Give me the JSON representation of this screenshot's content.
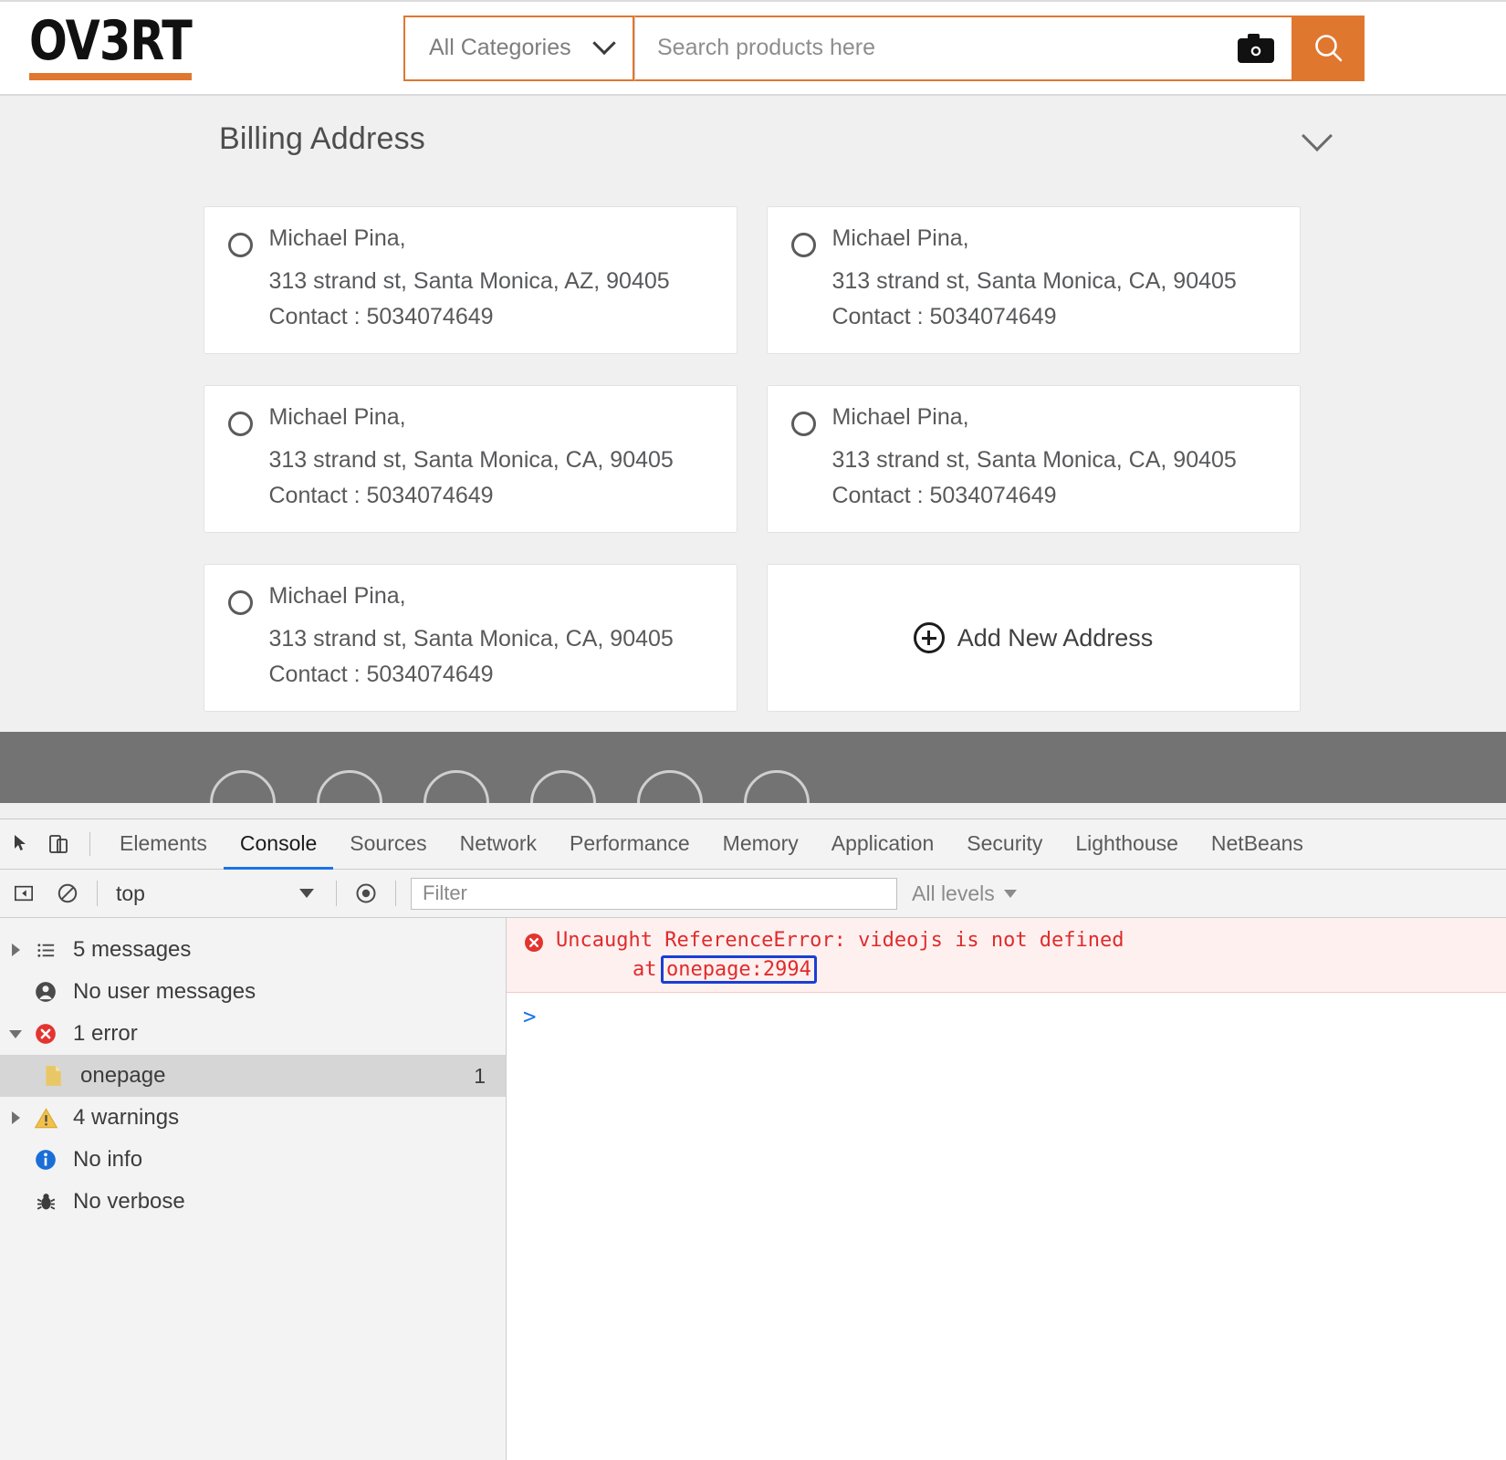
{
  "header": {
    "logo_text": "OV3RT",
    "category_select": {
      "label": "All Categories",
      "icon": "chevron-down-icon"
    },
    "search": {
      "placeholder": "Search products here",
      "value": ""
    },
    "camera_icon": "camera-icon",
    "search_icon": "search-icon",
    "accent_color": "#e0772f"
  },
  "billing": {
    "title": "Billing Address",
    "collapse_icon": "chevron-down-icon",
    "addresses": [
      {
        "name": "Michael Pina,",
        "street": "313 strand st, Santa Monica, AZ, 90405",
        "contact": "Contact : 5034074649",
        "selected": false
      },
      {
        "name": "Michael Pina,",
        "street": "313 strand st, Santa Monica, CA, 90405",
        "contact": "Contact : 5034074649",
        "selected": false
      },
      {
        "name": "Michael Pina,",
        "street": "313 strand st, Santa Monica, CA, 90405",
        "contact": "Contact : 5034074649",
        "selected": false
      },
      {
        "name": "Michael Pina,",
        "street": "313 strand st, Santa Monica, CA, 90405",
        "contact": "Contact : 5034074649",
        "selected": false
      },
      {
        "name": "Michael Pina,",
        "street": "313 strand st, Santa Monica, CA, 90405",
        "contact": "Contact : 5034074649",
        "selected": false
      }
    ],
    "add_new": {
      "label": "Add New Address",
      "icon": "plus-circle-icon"
    }
  },
  "devtools": {
    "tools": [
      "inspect-element-icon",
      "device-toolbar-icon"
    ],
    "tabs": [
      {
        "label": "Elements",
        "active": false
      },
      {
        "label": "Console",
        "active": true
      },
      {
        "label": "Sources",
        "active": false
      },
      {
        "label": "Network",
        "active": false
      },
      {
        "label": "Performance",
        "active": false
      },
      {
        "label": "Memory",
        "active": false
      },
      {
        "label": "Application",
        "active": false
      },
      {
        "label": "Security",
        "active": false
      },
      {
        "label": "Lighthouse",
        "active": false
      },
      {
        "label": "NetBeans",
        "active": false
      }
    ],
    "toolbar": {
      "sidebar_toggle_icon": "console-sidebar-toggle-icon",
      "clear_icon": "clear-console-icon",
      "context": "top",
      "eye_icon": "live-expression-icon",
      "filter_placeholder": "Filter",
      "filter_value": "",
      "levels_label": "All levels"
    },
    "sidebar": [
      {
        "label": "5 messages",
        "icon": "list-icon",
        "arrow": "right",
        "count": "",
        "selected": false,
        "child": false
      },
      {
        "label": "No user messages",
        "icon": "user-icon",
        "arrow": "none",
        "count": "",
        "selected": false,
        "child": false
      },
      {
        "label": "1 error",
        "icon": "error-icon",
        "arrow": "down",
        "count": "",
        "selected": false,
        "child": false
      },
      {
        "label": "onepage",
        "icon": "file-icon",
        "arrow": "none",
        "count": "1",
        "selected": true,
        "child": true
      },
      {
        "label": "4 warnings",
        "icon": "warning-icon",
        "arrow": "right",
        "count": "",
        "selected": false,
        "child": false
      },
      {
        "label": "No info",
        "icon": "info-icon",
        "arrow": "none",
        "count": "",
        "selected": false,
        "child": false
      },
      {
        "label": "No verbose",
        "icon": "verbose-icon",
        "arrow": "none",
        "count": "",
        "selected": false,
        "child": false
      }
    ],
    "console": {
      "error_message": "Uncaught ReferenceError: videojs is not defined",
      "error_at": "at",
      "error_source_link": "onepage:2994",
      "prompt_caret": ">",
      "prompt_value": ""
    }
  }
}
